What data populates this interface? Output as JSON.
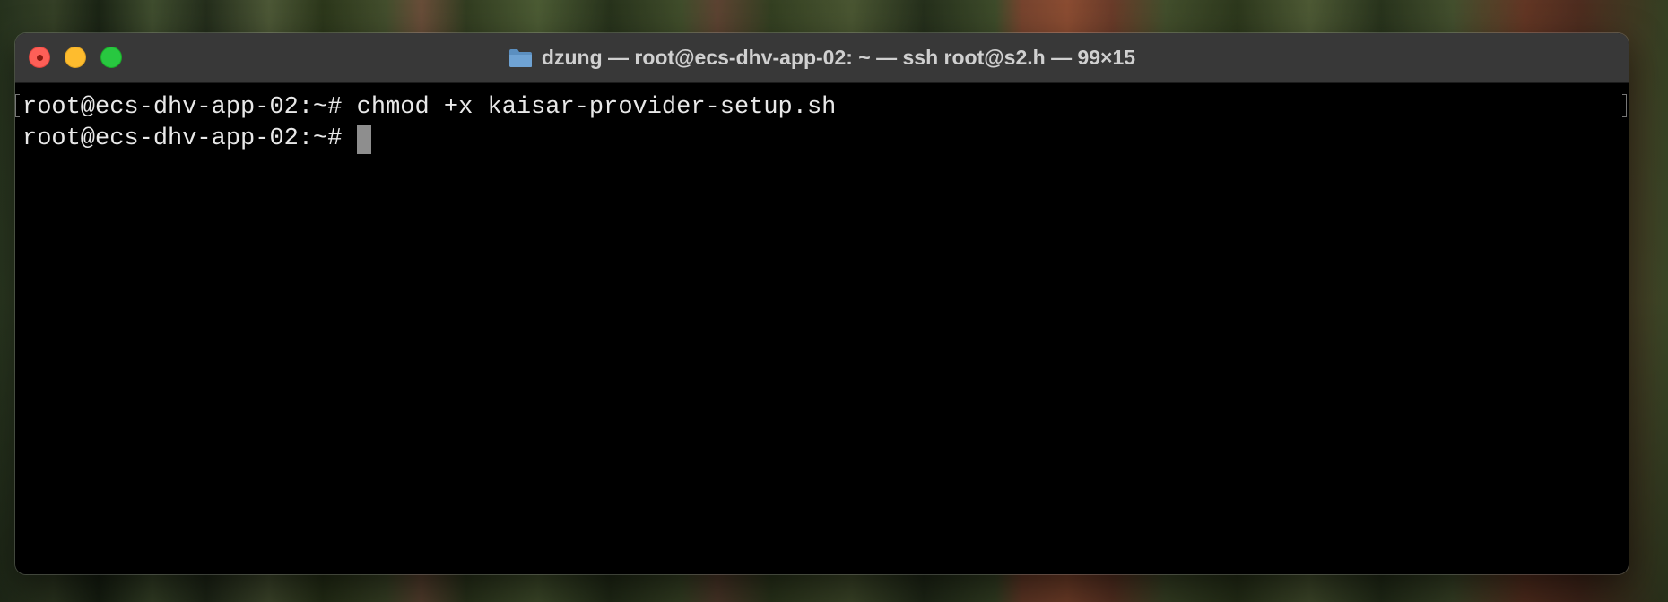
{
  "window": {
    "title": "dzung — root@ecs-dhv-app-02: ~ — ssh root@s2.h — 99×15",
    "folder_icon": "folder-icon",
    "colors": {
      "close": "#fe5f57",
      "minimize": "#febc2e",
      "maximize": "#28c840",
      "titlebar": "#383838",
      "terminal_bg": "#000000",
      "terminal_fg": "#e8e8e8"
    }
  },
  "terminal": {
    "lines": [
      {
        "prompt": "root@ecs-dhv-app-02:~# ",
        "command": "chmod +x kaisar-provider-setup.sh"
      },
      {
        "prompt": "root@ecs-dhv-app-02:~# ",
        "command": ""
      }
    ]
  }
}
